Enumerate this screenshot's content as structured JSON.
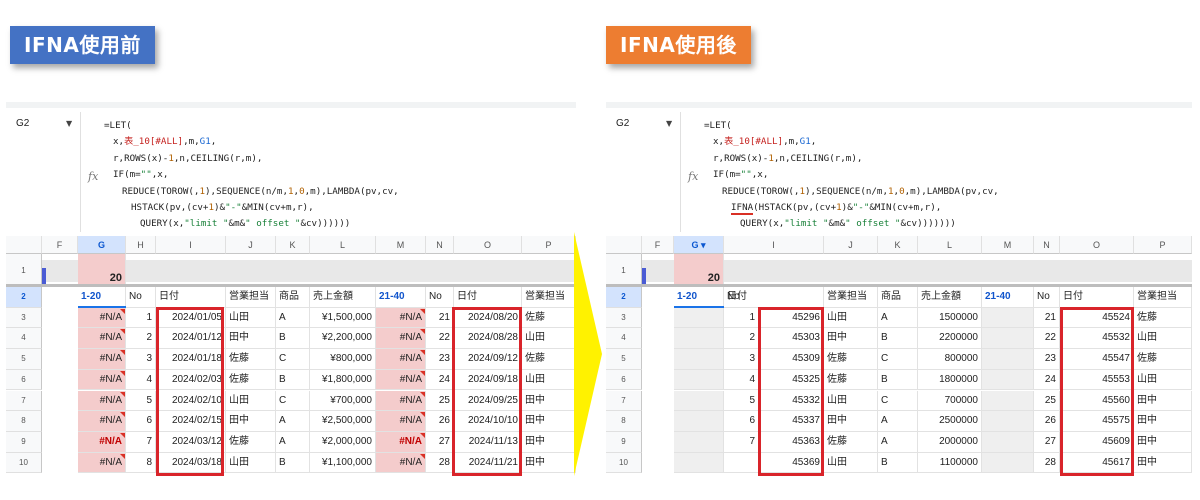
{
  "titles": {
    "before": "IFNA使用前",
    "after": "IFNA使用後"
  },
  "colors": {
    "before_badge": "#4472c4",
    "after_badge": "#ed7d31",
    "error_fill": "#f4cccc",
    "red_box": "#d9242a",
    "arrow": "#fff200"
  },
  "namebox": {
    "cell": "G2",
    "fx_icon": "fx-icon"
  },
  "formula_before": [
    "=LET(",
    "x,表_10[#ALL],m,G1,",
    "r,ROWS(x)-1,n,CEILING(r,m),",
    "IF(m=\"\",x,",
    "REDUCE(TOROW(,1),SEQUENCE(n/m,1,0,m),LAMBDA(pv,cv,",
    "HSTACK(pv,(cv+1)&\"-\"&MIN(cv+m,r),",
    "QUERY(x,\"limit \"&m&\" offset \"&cv))))))"
  ],
  "formula_after": [
    "=LET(",
    "x,表_10[#ALL],m,G1,",
    "r,ROWS(x)-1,n,CEILING(r,m),",
    "IF(m=\"\",x,",
    "REDUCE(TOROW(,1),SEQUENCE(n/m,1,0,m),LAMBDA(pv,cv,",
    "IFNA(HSTACK(pv,(cv+1)&\"-\"&MIN(cv+m,r),",
    "QUERY(x,\"limit \"&m&\" offset \"&cv)))))))"
  ],
  "columns": [
    "F",
    "G",
    "H",
    "I",
    "J",
    "K",
    "L",
    "M",
    "N",
    "O",
    "P"
  ],
  "row_numbers": [
    "1",
    "2",
    "3",
    "4",
    "5",
    "6",
    "7",
    "8",
    "9",
    "10"
  ],
  "g1_value": "20",
  "headers": {
    "range1": "1-20",
    "no": "No",
    "date": "日付",
    "rep": "営業担当",
    "product": "商品",
    "amount": "売上金額",
    "range2": "21-40"
  },
  "before_rows": [
    {
      "g": "#N/A",
      "no": "1",
      "date": "2024/01/05",
      "rep": "山田",
      "prod": "A",
      "amt": "¥1,500,000",
      "m": "#N/A",
      "no2": "21",
      "date2": "2024/08/20",
      "rep2": "佐藤"
    },
    {
      "g": "#N/A",
      "no": "2",
      "date": "2024/01/12",
      "rep": "田中",
      "prod": "B",
      "amt": "¥2,200,000",
      "m": "#N/A",
      "no2": "22",
      "date2": "2024/08/28",
      "rep2": "山田"
    },
    {
      "g": "#N/A",
      "no": "3",
      "date": "2024/01/18",
      "rep": "佐藤",
      "prod": "C",
      "amt": "¥800,000",
      "m": "#N/A",
      "no2": "23",
      "date2": "2024/09/12",
      "rep2": "佐藤"
    },
    {
      "g": "#N/A",
      "no": "4",
      "date": "2024/02/03",
      "rep": "佐藤",
      "prod": "B",
      "amt": "¥1,800,000",
      "m": "#N/A",
      "no2": "24",
      "date2": "2024/09/18",
      "rep2": "山田"
    },
    {
      "g": "#N/A",
      "no": "5",
      "date": "2024/02/10",
      "rep": "山田",
      "prod": "C",
      "amt": "¥700,000",
      "m": "#N/A",
      "no2": "25",
      "date2": "2024/09/25",
      "rep2": "田中"
    },
    {
      "g": "#N/A",
      "no": "6",
      "date": "2024/02/15",
      "rep": "田中",
      "prod": "A",
      "amt": "¥2,500,000",
      "m": "#N/A",
      "no2": "26",
      "date2": "2024/10/10",
      "rep2": "田中"
    },
    {
      "g": "#N/A",
      "no": "7",
      "date": "2024/03/12",
      "rep": "佐藤",
      "prod": "A",
      "amt": "¥2,000,000",
      "m": "#N/A",
      "no2": "27",
      "date2": "2024/11/13",
      "rep2": "田中"
    },
    {
      "g": "#N/A",
      "no": "8",
      "date": "2024/03/18",
      "rep": "山田",
      "prod": "B",
      "amt": "¥1,100,000",
      "m": "#N/A",
      "no2": "28",
      "date2": "2024/11/21",
      "rep2": "田中"
    }
  ],
  "after_rows": [
    {
      "no": "1",
      "date": "45296",
      "rep": "山田",
      "prod": "A",
      "amt": "1500000",
      "no2": "21",
      "date2": "45524",
      "rep2": "佐藤"
    },
    {
      "no": "2",
      "date": "45303",
      "rep": "田中",
      "prod": "B",
      "amt": "2200000",
      "no2": "22",
      "date2": "45532",
      "rep2": "山田"
    },
    {
      "no": "3",
      "date": "45309",
      "rep": "佐藤",
      "prod": "C",
      "amt": "800000",
      "no2": "23",
      "date2": "45547",
      "rep2": "佐藤"
    },
    {
      "no": "4",
      "date": "45325",
      "rep": "佐藤",
      "prod": "B",
      "amt": "1800000",
      "no2": "24",
      "date2": "45553",
      "rep2": "山田"
    },
    {
      "no": "5",
      "date": "45332",
      "rep": "山田",
      "prod": "C",
      "amt": "700000",
      "no2": "25",
      "date2": "45560",
      "rep2": "田中"
    },
    {
      "no": "6",
      "date": "45337",
      "rep": "田中",
      "prod": "A",
      "amt": "2500000",
      "no2": "26",
      "date2": "45575",
      "rep2": "田中"
    },
    {
      "no": "7",
      "date": "45363",
      "rep": "佐藤",
      "prod": "A",
      "amt": "2000000",
      "no2": "27",
      "date2": "45609",
      "rep2": "田中"
    },
    {
      "no": "",
      "date": "45369",
      "rep": "山田",
      "prod": "B",
      "amt": "1100000",
      "no2": "28",
      "date2": "45617",
      "rep2": "田中"
    }
  ]
}
